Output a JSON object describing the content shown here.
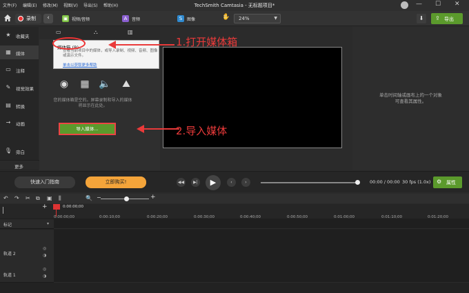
{
  "menubar": {
    "items": [
      "文件(F)",
      "编辑(E)",
      "修改(M)",
      "视图(V)",
      "导出(S)",
      "帮助(H)"
    ],
    "title": "TechSmith Camtasia - 无标题项目*"
  },
  "toolbar": {
    "record_label": "录制",
    "tabs": [
      {
        "label": "视频/音频",
        "icon": "video-audio-icon",
        "color": "#7dc242"
      },
      {
        "label": "音频",
        "icon": "audio-icon",
        "color": "#8a5fd0"
      },
      {
        "label": "图像",
        "icon": "image-icon",
        "color": "#2f8ad0"
      },
      {
        "label": "导出",
        "icon": "export-icon",
        "color": "#d44"
      }
    ],
    "zoom": "24%",
    "export_label": "导出"
  },
  "sidebar": {
    "items": [
      {
        "label": "收藏夹",
        "icon": "star-icon"
      },
      {
        "label": "媒体",
        "icon": "film-icon"
      },
      {
        "label": "注释",
        "icon": "annotation-icon"
      },
      {
        "label": "视觉效果",
        "icon": "wand-icon"
      },
      {
        "label": "转换",
        "icon": "transition-icon"
      },
      {
        "label": "动画",
        "icon": "animation-icon"
      },
      {
        "label": "旁白",
        "icon": "mic-icon"
      }
    ],
    "more_label": "更多"
  },
  "media_panel": {
    "tooltip": {
      "title": "媒体箱 (B)",
      "body": "查看当前项目中的媒体，或导入录制、视频、音频、图像或演示文件。",
      "link": "单击以获取更多帮助"
    },
    "empty_text": "您的媒体箱是空的。屏幕录制和导入的媒体将显示在此处。",
    "import_label": "导入媒体..."
  },
  "properties": {
    "empty_text_line1": "单击时间轴或画布上的一个对象",
    "empty_text_line2": "可查看其属性。"
  },
  "annotations": {
    "step1": "1.打开媒体箱",
    "step2": "2.导入媒体",
    "color": "#ea3a3a"
  },
  "playbar": {
    "quick_start": "快速入门指南",
    "buy_now": "立即购买!",
    "time": "00:00 / 00:00",
    "fps": "30 fps (1.0x)",
    "props_label": "属性"
  },
  "timeline": {
    "start_time": "0:00:00;00",
    "ruler_labels": [
      "0:00:00;00",
      "0:00:10;00",
      "0:00:20;00",
      "0:00:30;00",
      "0:00:40;00",
      "0:00:50;00",
      "0:01:00;00",
      "0:01:10;00",
      "0:01:20;00"
    ],
    "marker_label": "标记",
    "tracks": [
      "轨道 2",
      "轨道 1"
    ]
  }
}
